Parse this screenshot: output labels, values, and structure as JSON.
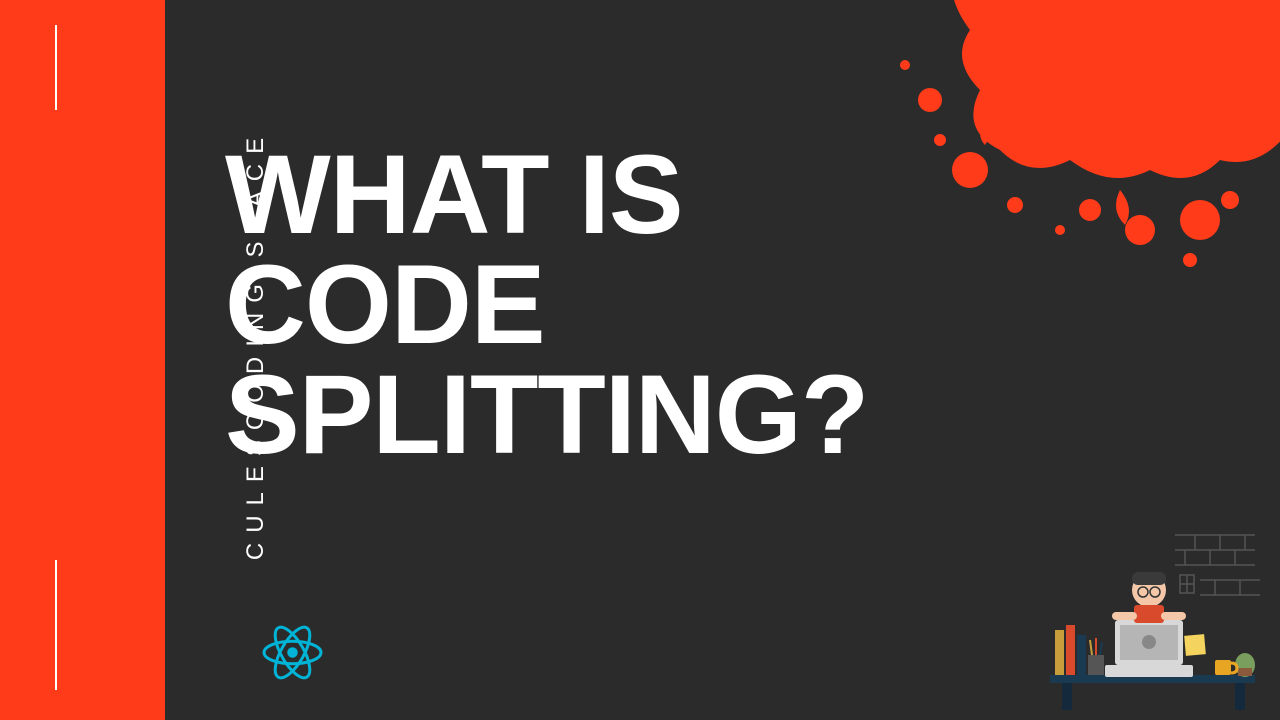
{
  "sidebar": {
    "brand_text": "CULESCODING.SPACE"
  },
  "main": {
    "title_line1": "WHAT IS",
    "title_line2": "CODE",
    "title_line3": "SPLITTING?"
  },
  "logo": {
    "name": "react-logo"
  },
  "colors": {
    "accent": "#ff3b1a",
    "background": "#2b2b2b",
    "text": "#ffffff",
    "react_blue": "#00b4d8"
  }
}
